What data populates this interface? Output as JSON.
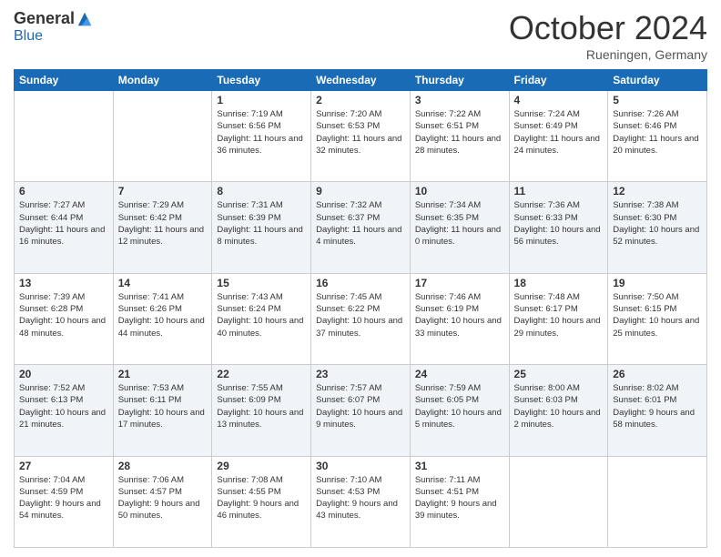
{
  "header": {
    "logo": {
      "general": "General",
      "blue": "Blue"
    },
    "title": "October 2024",
    "location": "Rueningen, Germany"
  },
  "days_of_week": [
    "Sunday",
    "Monday",
    "Tuesday",
    "Wednesday",
    "Thursday",
    "Friday",
    "Saturday"
  ],
  "weeks": [
    [
      {
        "day": "",
        "sunrise": "",
        "sunset": "",
        "daylight": ""
      },
      {
        "day": "",
        "sunrise": "",
        "sunset": "",
        "daylight": ""
      },
      {
        "day": "1",
        "sunrise": "Sunrise: 7:19 AM",
        "sunset": "Sunset: 6:56 PM",
        "daylight": "Daylight: 11 hours and 36 minutes."
      },
      {
        "day": "2",
        "sunrise": "Sunrise: 7:20 AM",
        "sunset": "Sunset: 6:53 PM",
        "daylight": "Daylight: 11 hours and 32 minutes."
      },
      {
        "day": "3",
        "sunrise": "Sunrise: 7:22 AM",
        "sunset": "Sunset: 6:51 PM",
        "daylight": "Daylight: 11 hours and 28 minutes."
      },
      {
        "day": "4",
        "sunrise": "Sunrise: 7:24 AM",
        "sunset": "Sunset: 6:49 PM",
        "daylight": "Daylight: 11 hours and 24 minutes."
      },
      {
        "day": "5",
        "sunrise": "Sunrise: 7:26 AM",
        "sunset": "Sunset: 6:46 PM",
        "daylight": "Daylight: 11 hours and 20 minutes."
      }
    ],
    [
      {
        "day": "6",
        "sunrise": "Sunrise: 7:27 AM",
        "sunset": "Sunset: 6:44 PM",
        "daylight": "Daylight: 11 hours and 16 minutes."
      },
      {
        "day": "7",
        "sunrise": "Sunrise: 7:29 AM",
        "sunset": "Sunset: 6:42 PM",
        "daylight": "Daylight: 11 hours and 12 minutes."
      },
      {
        "day": "8",
        "sunrise": "Sunrise: 7:31 AM",
        "sunset": "Sunset: 6:39 PM",
        "daylight": "Daylight: 11 hours and 8 minutes."
      },
      {
        "day": "9",
        "sunrise": "Sunrise: 7:32 AM",
        "sunset": "Sunset: 6:37 PM",
        "daylight": "Daylight: 11 hours and 4 minutes."
      },
      {
        "day": "10",
        "sunrise": "Sunrise: 7:34 AM",
        "sunset": "Sunset: 6:35 PM",
        "daylight": "Daylight: 11 hours and 0 minutes."
      },
      {
        "day": "11",
        "sunrise": "Sunrise: 7:36 AM",
        "sunset": "Sunset: 6:33 PM",
        "daylight": "Daylight: 10 hours and 56 minutes."
      },
      {
        "day": "12",
        "sunrise": "Sunrise: 7:38 AM",
        "sunset": "Sunset: 6:30 PM",
        "daylight": "Daylight: 10 hours and 52 minutes."
      }
    ],
    [
      {
        "day": "13",
        "sunrise": "Sunrise: 7:39 AM",
        "sunset": "Sunset: 6:28 PM",
        "daylight": "Daylight: 10 hours and 48 minutes."
      },
      {
        "day": "14",
        "sunrise": "Sunrise: 7:41 AM",
        "sunset": "Sunset: 6:26 PM",
        "daylight": "Daylight: 10 hours and 44 minutes."
      },
      {
        "day": "15",
        "sunrise": "Sunrise: 7:43 AM",
        "sunset": "Sunset: 6:24 PM",
        "daylight": "Daylight: 10 hours and 40 minutes."
      },
      {
        "day": "16",
        "sunrise": "Sunrise: 7:45 AM",
        "sunset": "Sunset: 6:22 PM",
        "daylight": "Daylight: 10 hours and 37 minutes."
      },
      {
        "day": "17",
        "sunrise": "Sunrise: 7:46 AM",
        "sunset": "Sunset: 6:19 PM",
        "daylight": "Daylight: 10 hours and 33 minutes."
      },
      {
        "day": "18",
        "sunrise": "Sunrise: 7:48 AM",
        "sunset": "Sunset: 6:17 PM",
        "daylight": "Daylight: 10 hours and 29 minutes."
      },
      {
        "day": "19",
        "sunrise": "Sunrise: 7:50 AM",
        "sunset": "Sunset: 6:15 PM",
        "daylight": "Daylight: 10 hours and 25 minutes."
      }
    ],
    [
      {
        "day": "20",
        "sunrise": "Sunrise: 7:52 AM",
        "sunset": "Sunset: 6:13 PM",
        "daylight": "Daylight: 10 hours and 21 minutes."
      },
      {
        "day": "21",
        "sunrise": "Sunrise: 7:53 AM",
        "sunset": "Sunset: 6:11 PM",
        "daylight": "Daylight: 10 hours and 17 minutes."
      },
      {
        "day": "22",
        "sunrise": "Sunrise: 7:55 AM",
        "sunset": "Sunset: 6:09 PM",
        "daylight": "Daylight: 10 hours and 13 minutes."
      },
      {
        "day": "23",
        "sunrise": "Sunrise: 7:57 AM",
        "sunset": "Sunset: 6:07 PM",
        "daylight": "Daylight: 10 hours and 9 minutes."
      },
      {
        "day": "24",
        "sunrise": "Sunrise: 7:59 AM",
        "sunset": "Sunset: 6:05 PM",
        "daylight": "Daylight: 10 hours and 5 minutes."
      },
      {
        "day": "25",
        "sunrise": "Sunrise: 8:00 AM",
        "sunset": "Sunset: 6:03 PM",
        "daylight": "Daylight: 10 hours and 2 minutes."
      },
      {
        "day": "26",
        "sunrise": "Sunrise: 8:02 AM",
        "sunset": "Sunset: 6:01 PM",
        "daylight": "Daylight: 9 hours and 58 minutes."
      }
    ],
    [
      {
        "day": "27",
        "sunrise": "Sunrise: 7:04 AM",
        "sunset": "Sunset: 4:59 PM",
        "daylight": "Daylight: 9 hours and 54 minutes."
      },
      {
        "day": "28",
        "sunrise": "Sunrise: 7:06 AM",
        "sunset": "Sunset: 4:57 PM",
        "daylight": "Daylight: 9 hours and 50 minutes."
      },
      {
        "day": "29",
        "sunrise": "Sunrise: 7:08 AM",
        "sunset": "Sunset: 4:55 PM",
        "daylight": "Daylight: 9 hours and 46 minutes."
      },
      {
        "day": "30",
        "sunrise": "Sunrise: 7:10 AM",
        "sunset": "Sunset: 4:53 PM",
        "daylight": "Daylight: 9 hours and 43 minutes."
      },
      {
        "day": "31",
        "sunrise": "Sunrise: 7:11 AM",
        "sunset": "Sunset: 4:51 PM",
        "daylight": "Daylight: 9 hours and 39 minutes."
      },
      {
        "day": "",
        "sunrise": "",
        "sunset": "",
        "daylight": ""
      },
      {
        "day": "",
        "sunrise": "",
        "sunset": "",
        "daylight": ""
      }
    ]
  ]
}
